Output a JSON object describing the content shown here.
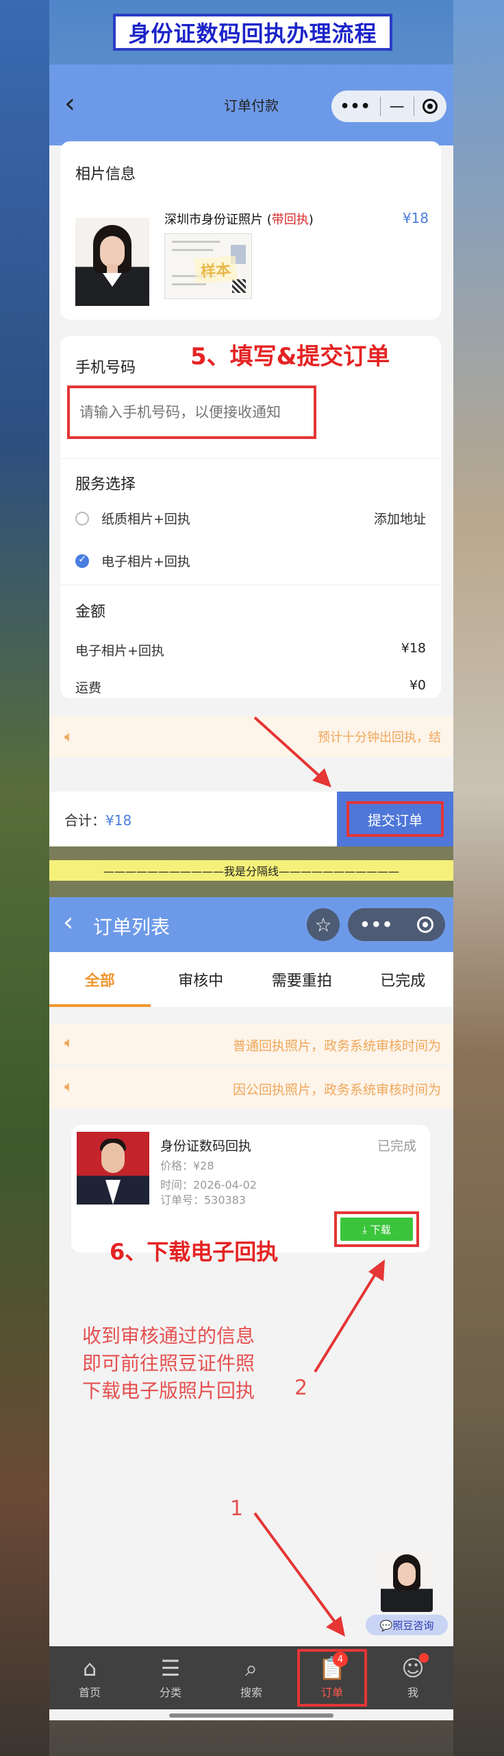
{
  "banner": {
    "title": "身份证数码回执办理流程"
  },
  "checkout": {
    "nav": {
      "title": "订单付款",
      "back_icon": "‹",
      "more": "•••",
      "minimize": "—"
    },
    "photo_info": {
      "section_title": "相片信息",
      "product_name": "深圳市身份证照片 (",
      "product_tag": "带回执",
      "product_name_end": ")",
      "price": "¥18",
      "sample_stamp": "样本"
    },
    "phone": {
      "section_title": "手机号码",
      "placeholder": "请输入手机号码，以便接收通知",
      "step_label": "5、填写&提交订单"
    },
    "service": {
      "section_title": "服务选择",
      "options": [
        {
          "label": "纸质相片+回执",
          "selected": false,
          "extra": "添加地址"
        },
        {
          "label": "电子相片+回执",
          "selected": true
        }
      ]
    },
    "amount": {
      "section_title": "金额",
      "rows": [
        {
          "label": "电子相片+回执",
          "value": "¥18"
        },
        {
          "label": "运费",
          "value": "¥0"
        }
      ]
    },
    "notice": "预计十分钟出回执，结",
    "footer": {
      "total_label": "合计：",
      "total_value": "¥18",
      "submit_label": "提交订单"
    }
  },
  "separator": "———————————我是分隔线———————————",
  "orders": {
    "nav": {
      "title": "订单列表",
      "back_icon": "‹",
      "star": "☆",
      "more": "•••"
    },
    "tabs": [
      {
        "label": "全部",
        "active": true
      },
      {
        "label": "审核中",
        "active": false
      },
      {
        "label": "需要重拍",
        "active": false
      },
      {
        "label": "已完成",
        "active": false
      }
    ],
    "notices": [
      "普通回执照片，政务系统审核时间为",
      "因公回执照片，政务系统审核时间为"
    ],
    "order": {
      "title": "身份证数码回执",
      "status": "已完成",
      "price": "价格：¥28",
      "time": "时间：2026-04-02",
      "order_no": "订单号：530383",
      "download_label": "⤓ 下载"
    },
    "step_label": "6、下载电子回执",
    "info_lines": [
      "收到审核通过的信息",
      "即可前往照豆证件照",
      "下载电子版照片回执"
    ],
    "marker_2": "2",
    "marker_1": "1",
    "assistant_label": "💬照豆咨询",
    "bottom_nav": [
      {
        "label": "首页",
        "icon": "⌂"
      },
      {
        "label": "分类",
        "icon": "☰"
      },
      {
        "label": "搜索",
        "icon": "⌕"
      },
      {
        "label": "订单",
        "icon": "📋",
        "badge": "4",
        "current": true
      },
      {
        "label": "我",
        "icon": "☺",
        "dot": true
      }
    ]
  },
  "colors": {
    "accent": "#6d9ae8",
    "highlight": "#e53535",
    "orange": "#f0962e",
    "download": "#3cc53c"
  }
}
